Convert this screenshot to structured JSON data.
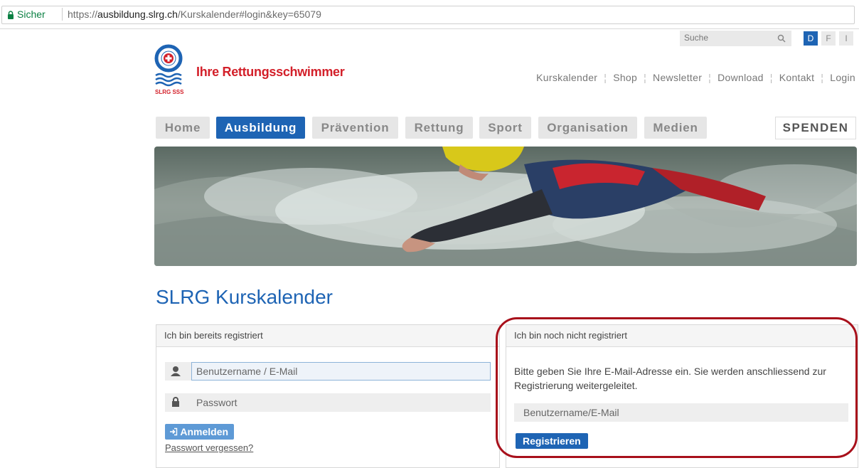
{
  "browser": {
    "secure_label": "Sicher",
    "url_protocol": "https://",
    "url_domain": "ausbildung.slrg.ch",
    "url_path": "/Kurskalender#login&key=65079"
  },
  "header": {
    "search_placeholder": "Suche",
    "languages": [
      "D",
      "F",
      "I"
    ],
    "brand_name": "Ihre Rettungsschwimmer",
    "logo_caption": "SLRG SSS",
    "meta_nav": [
      "Kurskalender",
      "Shop",
      "Newsletter",
      "Download",
      "Kontakt",
      "Login"
    ]
  },
  "main_nav": {
    "tabs": [
      "Home",
      "Ausbildung",
      "Prävention",
      "Rettung",
      "Sport",
      "Organisation",
      "Medien"
    ],
    "active": "Ausbildung",
    "donate_label": "SPENDEN"
  },
  "page": {
    "title": "SLRG Kurskalender"
  },
  "login_panel": {
    "heading": "Ich bin bereits registriert",
    "username_placeholder": "Benutzername / E-Mail",
    "password_placeholder": "Passwort",
    "login_button": "Anmelden",
    "forgot_link": "Passwort vergessen?"
  },
  "register_panel": {
    "heading": "Ich bin noch nicht registriert",
    "info_text": "Bitte geben Sie Ihre E-Mail-Adresse ein. Sie werden anschliessend zur Registrierung weitergeleitet.",
    "email_placeholder": "Benutzername/E-Mail",
    "register_button": "Registrieren"
  },
  "colors": {
    "accent": "#1e64b4",
    "brand_red": "#d3202a",
    "annotation": "#a8101b"
  }
}
